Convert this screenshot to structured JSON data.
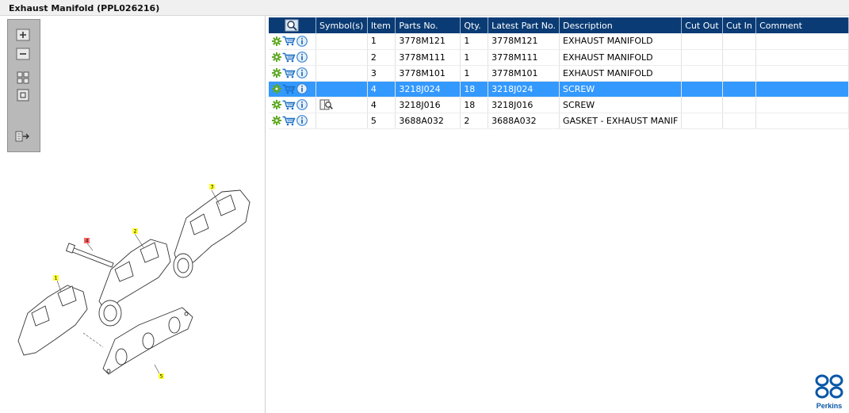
{
  "window": {
    "title": "Exhaust Manifold (PPL026216)"
  },
  "toolbar": {
    "tools": [
      {
        "name": "zoom-in-icon"
      },
      {
        "name": "zoom-out-icon"
      },
      {
        "name": "fit-page-icon"
      },
      {
        "name": "actual-size-icon"
      },
      {
        "name": "export-icon"
      }
    ]
  },
  "diagram": {
    "callouts": [
      {
        "label": "1",
        "color": "#ffff33"
      },
      {
        "label": "2",
        "color": "#ffff33"
      },
      {
        "label": "3",
        "color": "#ffff33"
      },
      {
        "label": "4",
        "color": "#ff6666"
      },
      {
        "label": "5",
        "color": "#ffff33"
      }
    ]
  },
  "table": {
    "columns": [
      "",
      "Symbol(s)",
      "Item",
      "Parts No.",
      "Qty.",
      "Latest Part No.",
      "Description",
      "Cut Out",
      "Cut In",
      "Comment"
    ],
    "header_icon": "magnifier-icon",
    "rows": [
      {
        "item": "1",
        "part_no": "3778M121",
        "qty": "1",
        "latest": "3778M121",
        "description": "EXHAUST MANIFOLD",
        "cut_out": "",
        "cut_in": "",
        "comment": "",
        "symbol": ""
      },
      {
        "item": "2",
        "part_no": "3778M111",
        "qty": "1",
        "latest": "3778M111",
        "description": "EXHAUST MANIFOLD",
        "cut_out": "",
        "cut_in": "",
        "comment": "",
        "symbol": ""
      },
      {
        "item": "3",
        "part_no": "3778M101",
        "qty": "1",
        "latest": "3778M101",
        "description": "EXHAUST MANIFOLD",
        "cut_out": "",
        "cut_in": "",
        "comment": "",
        "symbol": ""
      },
      {
        "item": "4",
        "part_no": "3218J024",
        "qty": "18",
        "latest": "3218J024",
        "description": "SCREW",
        "cut_out": "",
        "cut_in": "",
        "comment": "",
        "symbol": "",
        "selected": true
      },
      {
        "item": "4",
        "part_no": "3218J016",
        "qty": "18",
        "latest": "3218J016",
        "description": "SCREW",
        "cut_out": "",
        "cut_in": "",
        "comment": "",
        "symbol": "book-magnifier-icon"
      },
      {
        "item": "5",
        "part_no": "3688A032",
        "qty": "2",
        "latest": "3688A032",
        "description": "GASKET - EXHAUST MANIF",
        "cut_out": "",
        "cut_in": "",
        "comment": "",
        "symbol": ""
      }
    ]
  },
  "brand": {
    "name": "Perkins",
    "color": "#0a57a8"
  },
  "colors": {
    "header": "#0a3b74",
    "selection": "#3399ff",
    "gear": "#5fa825",
    "cart": "#1a6fc4",
    "info": "#3a86d4"
  }
}
